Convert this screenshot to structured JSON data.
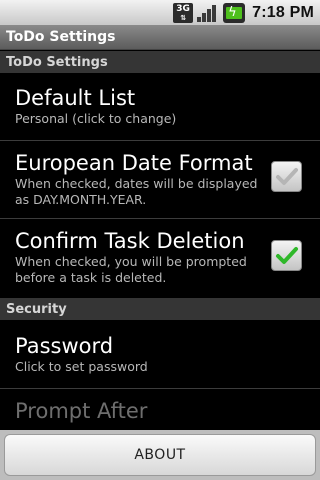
{
  "status_bar": {
    "network_label": "3G",
    "signal_icon": "signal-strength-icon",
    "battery_icon": "battery-charging-icon",
    "time": "7:18 PM"
  },
  "title_bar": {
    "title": "ToDo Settings"
  },
  "sections": {
    "todo_settings": "ToDo Settings",
    "security": "Security"
  },
  "preferences": {
    "default_list": {
      "title": "Default List",
      "summary": "Personal (click to change)"
    },
    "european_date_format": {
      "title": "European Date Format",
      "summary": "When checked, dates will be displayed as DAY.MONTH.YEAR.",
      "checked": false
    },
    "confirm_task_deletion": {
      "title": "Confirm Task Deletion",
      "summary": "When checked, you will be prompted before a task is deleted.",
      "checked": true
    },
    "password": {
      "title": "Password",
      "summary": "Click to set password"
    },
    "prompt_after": {
      "title": "Prompt After",
      "enabled": false
    }
  },
  "footer": {
    "about_label": "ABOUT"
  },
  "colors": {
    "checkmark_active": "#2fb82a",
    "checkmark_inactive": "#b5b5b5",
    "background": "#000000"
  }
}
